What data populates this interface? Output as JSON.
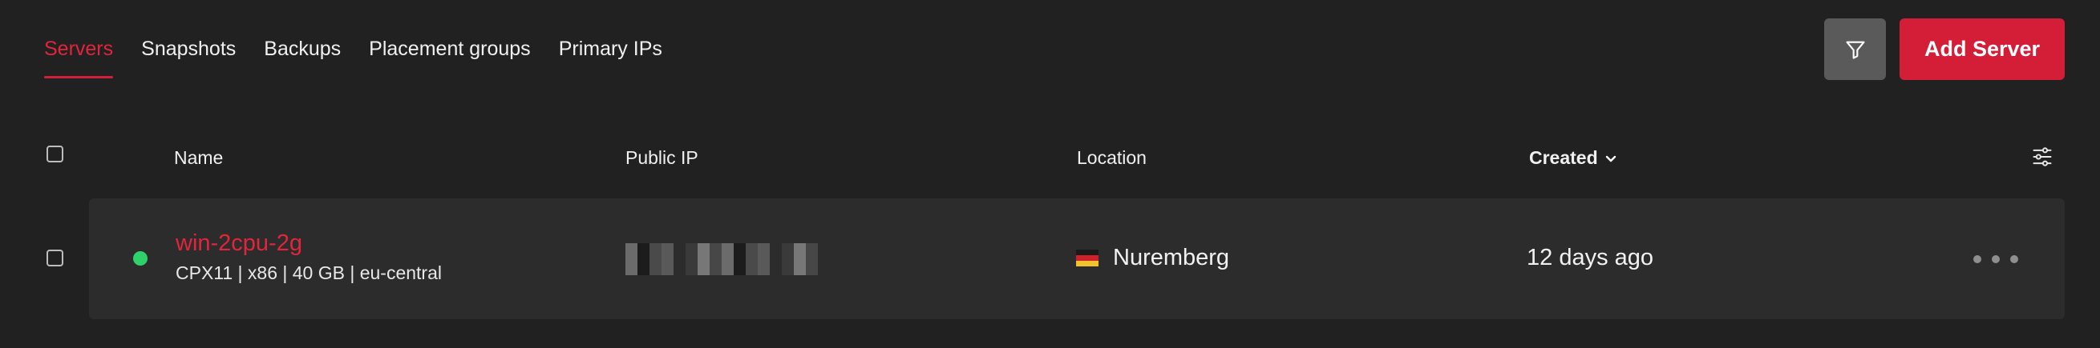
{
  "tabs": [
    {
      "label": "Servers",
      "active": true
    },
    {
      "label": "Snapshots",
      "active": false
    },
    {
      "label": "Backups",
      "active": false
    },
    {
      "label": "Placement groups",
      "active": false
    },
    {
      "label": "Primary IPs",
      "active": false
    }
  ],
  "toolbar": {
    "filter_icon": "filter-icon",
    "add_server_label": "Add Server"
  },
  "table": {
    "columns": {
      "name": "Name",
      "public_ip": "Public IP",
      "location": "Location",
      "created": "Created"
    },
    "sort_icon": "chevron-down-icon",
    "settings_icon": "sliders-icon",
    "rows": [
      {
        "status": "running",
        "name": "win-2cpu-2g",
        "meta": "CPX11 | x86 | 40 GB | eu-central",
        "public_ip": "(pixelated)",
        "location": "Nuremberg",
        "flag_icon": "germany-flag-icon",
        "created": "12 days ago"
      }
    ]
  },
  "colors": {
    "background": "#212121",
    "row_background": "#2c2c2c",
    "accent": "#d41e38",
    "status_running": "#2fd16a",
    "filter_button": "#5a5a5a"
  }
}
